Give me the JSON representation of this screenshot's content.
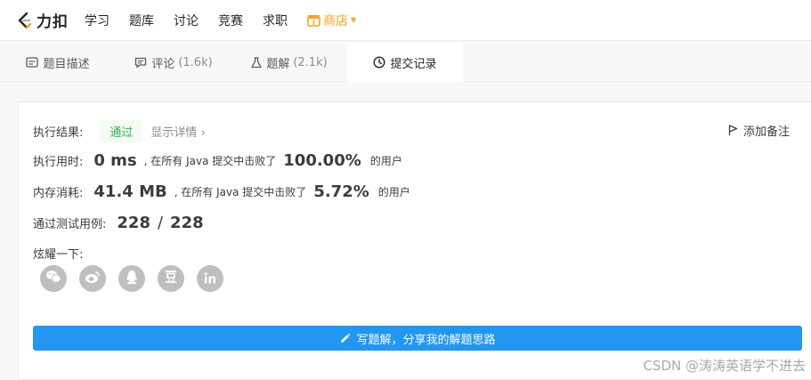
{
  "nav": {
    "logo_text": "力扣",
    "items": [
      "学习",
      "题库",
      "讨论",
      "竞赛",
      "求职"
    ],
    "store_label": "商店",
    "accent": "#ffa116"
  },
  "tabs": [
    {
      "label": "题目描述",
      "count": "",
      "icon": "description-icon"
    },
    {
      "label": "评论",
      "count": "(1.6k)",
      "icon": "comment-icon"
    },
    {
      "label": "题解",
      "count": "(2.1k)",
      "icon": "flask-icon"
    },
    {
      "label": "提交记录",
      "count": "",
      "icon": "clock-icon"
    }
  ],
  "result": {
    "label": "执行结果:",
    "status": "通过",
    "details": "显示详情",
    "details_arrow": "›",
    "note_label": "添加备注"
  },
  "runtime": {
    "label": "执行用时:",
    "value": "0 ms",
    "mid": ", 在所有 Java 提交中击败了",
    "percent": "100.00%",
    "tail": "的用户"
  },
  "memory": {
    "label": "内存消耗:",
    "value": "41.4 MB",
    "mid": ", 在所有 Java 提交中击败了",
    "percent": "5.72%",
    "tail": "的用户"
  },
  "tests": {
    "label": "通过测试用例:",
    "passed": "228",
    "sep": "/",
    "total": "228"
  },
  "share": {
    "label": "炫耀一下:",
    "icons": [
      "wechat-icon",
      "weibo-icon",
      "qq-icon",
      "douban-icon",
      "linkedin-icon"
    ]
  },
  "write_button": "写题解，分享我的解题思路",
  "watermark": "CSDN @涛涛英语学不进去",
  "colors": {
    "success": "#2db55d",
    "primary_button": "#2196f3"
  }
}
